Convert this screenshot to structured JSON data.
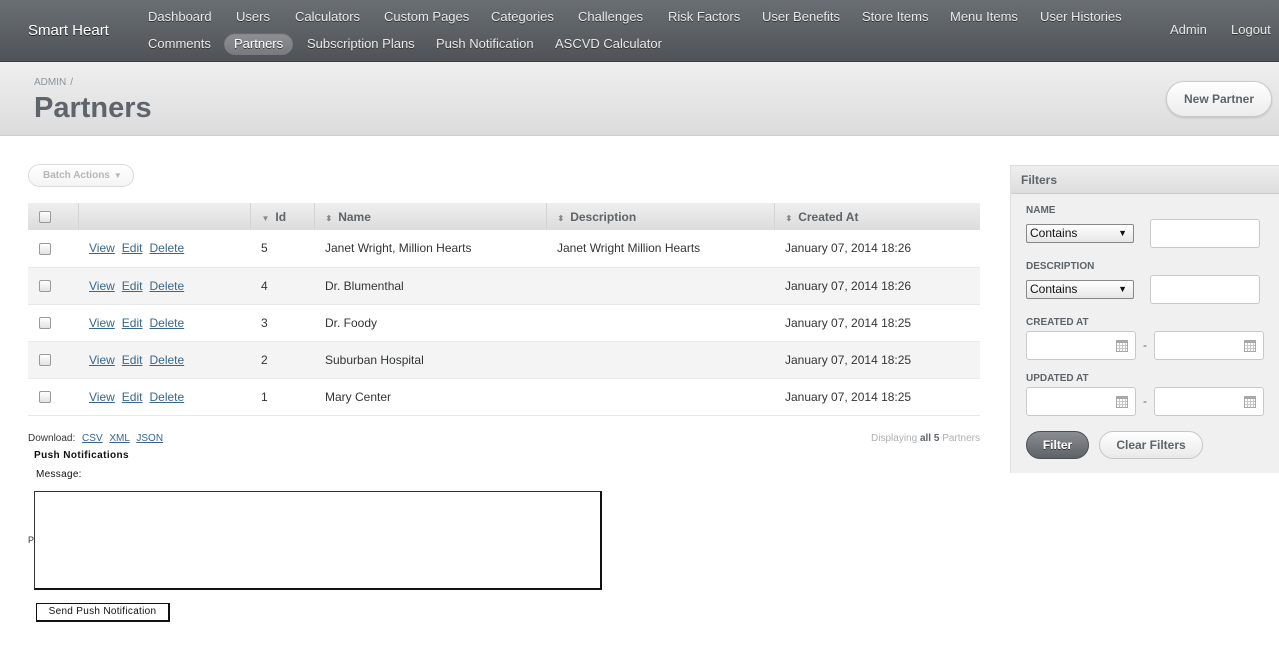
{
  "header": {
    "site_title": "Smart Heart",
    "nav_row1": [
      "Dashboard",
      "Users",
      "Calculators",
      "Custom Pages",
      "Categories",
      "Challenges",
      "Risk Factors",
      "User Benefits",
      "Store Items",
      "Menu Items",
      "User Histories"
    ],
    "nav_row2": [
      "Comments",
      "Partners",
      "Subscription Plans",
      "Push Notification",
      "ASCVD Calculator"
    ],
    "active_nav": "Partners",
    "utility": {
      "admin": "Admin",
      "logout": "Logout"
    }
  },
  "title_bar": {
    "breadcrumb": "ADMIN",
    "breadcrumb_sep": "/",
    "title": "Partners",
    "new_button": "New Partner"
  },
  "batch_actions": {
    "label": "Batch Actions"
  },
  "table": {
    "columns": [
      "Id",
      "Name",
      "Description",
      "Created At"
    ],
    "action_labels": {
      "view": "View",
      "edit": "Edit",
      "delete": "Delete"
    },
    "rows": [
      {
        "id": "5",
        "name": "Janet Wright, Million Hearts",
        "description": "Janet Wright Million Hearts",
        "created_at": "January 07, 2014 18:26"
      },
      {
        "id": "4",
        "name": "Dr. Blumenthal",
        "description": "",
        "created_at": "January 07, 2014 18:26"
      },
      {
        "id": "3",
        "name": "Dr. Foody",
        "description": "",
        "created_at": "January 07, 2014 18:25"
      },
      {
        "id": "2",
        "name": "Suburban Hospital",
        "description": "",
        "created_at": "January 07, 2014 18:25"
      },
      {
        "id": "1",
        "name": "Mary Center",
        "description": "",
        "created_at": "January 07, 2014 18:25"
      }
    ]
  },
  "download": {
    "label": "Download:",
    "formats": [
      "CSV",
      "XML",
      "JSON"
    ]
  },
  "pagination": {
    "prefix": "Displaying",
    "all": "all",
    "count": "5",
    "suffix": "Partners"
  },
  "push": {
    "title": "Push Notifications",
    "message_label": "Message:",
    "stray_char": "P",
    "message_value": "",
    "send_button": "Send Push Notification"
  },
  "filters": {
    "title": "Filters",
    "name_label": "NAME",
    "name_op": "Contains",
    "description_label": "DESCRIPTION",
    "description_op": "Contains",
    "created_label": "CREATED AT",
    "updated_label": "UPDATED AT",
    "range_sep": "-",
    "filter_button": "Filter",
    "clear_button": "Clear Filters"
  }
}
